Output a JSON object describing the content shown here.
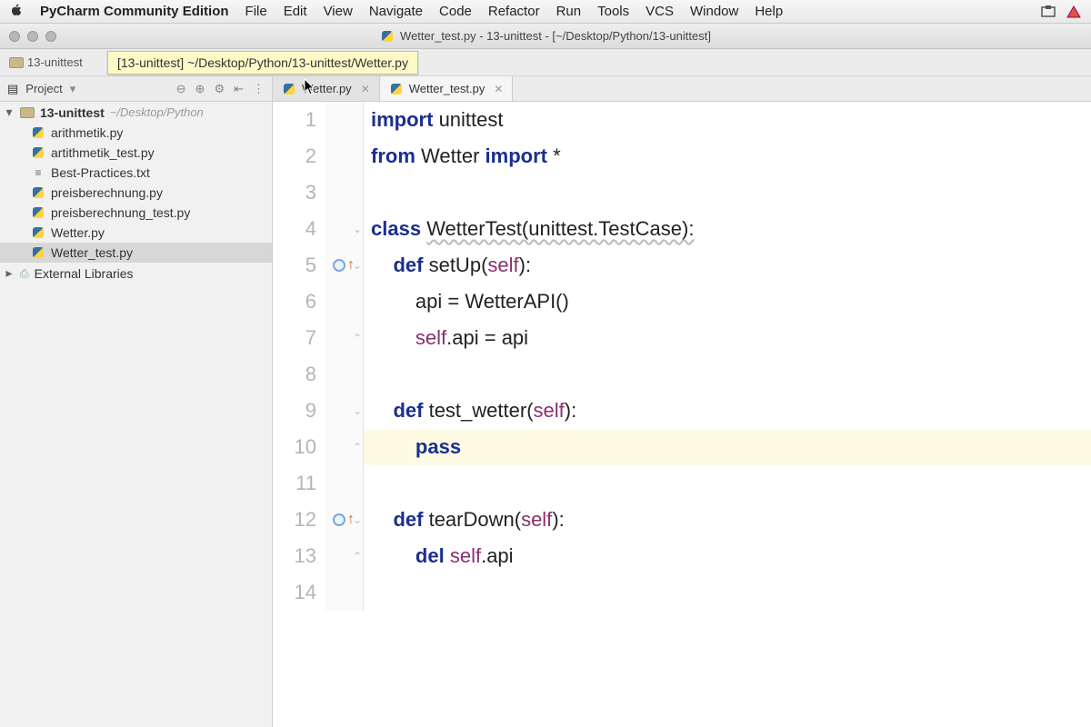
{
  "menubar": {
    "app_name": "PyCharm Community Edition",
    "items": [
      "File",
      "Edit",
      "View",
      "Navigate",
      "Code",
      "Refactor",
      "Run",
      "Tools",
      "VCS",
      "Window",
      "Help"
    ]
  },
  "window": {
    "title": "Wetter_test.py - 13-unittest - [~/Desktop/Python/13-unittest]"
  },
  "breadcrumb": {
    "root": "13-unittest",
    "tooltip": "[13-unittest] ~/Desktop/Python/13-unittest/Wetter.py"
  },
  "project_panel": {
    "label": "Project"
  },
  "tabs": [
    {
      "label": "Wetter.py",
      "active": false
    },
    {
      "label": "Wetter_test.py",
      "active": true
    }
  ],
  "tree": {
    "root": {
      "name": "13-unittest",
      "path": "~/Desktop/Python"
    },
    "files": [
      {
        "name": "arithmetik.py",
        "type": "py"
      },
      {
        "name": "artithmetik_test.py",
        "type": "py"
      },
      {
        "name": "Best-Practices.txt",
        "type": "txt"
      },
      {
        "name": "preisberechnung.py",
        "type": "py"
      },
      {
        "name": "preisberechnung_test.py",
        "type": "py"
      },
      {
        "name": "Wetter.py",
        "type": "py"
      },
      {
        "name": "Wetter_test.py",
        "type": "py",
        "selected": true
      }
    ],
    "external": "External Libraries"
  },
  "editor": {
    "highlighted_line": 10,
    "lines": [
      {
        "n": 1,
        "tokens": [
          [
            "kw",
            "import"
          ],
          [
            " ",
            ""
          ],
          [
            "id",
            "unittest"
          ]
        ]
      },
      {
        "n": 2,
        "tokens": [
          [
            "kw",
            "from"
          ],
          [
            " ",
            ""
          ],
          [
            "id",
            "Wetter"
          ],
          [
            " ",
            ""
          ],
          [
            "kw",
            "import"
          ],
          [
            " ",
            ""
          ],
          [
            "id",
            "*"
          ]
        ]
      },
      {
        "n": 3,
        "tokens": []
      },
      {
        "n": 4,
        "tokens": [
          [
            "kw",
            "class"
          ],
          [
            " ",
            ""
          ],
          [
            "cls",
            "WetterTest(unittest.TestCase):"
          ]
        ],
        "fold": "down"
      },
      {
        "n": 5,
        "indent": 1,
        "tokens": [
          [
            "kw",
            "def"
          ],
          [
            " ",
            ""
          ],
          [
            "fn",
            "setUp"
          ],
          [
            "id",
            "("
          ],
          [
            "self",
            "self"
          ],
          [
            "id",
            "):"
          ]
        ],
        "mark": "override",
        "fold": "down"
      },
      {
        "n": 6,
        "indent": 2,
        "tokens": [
          [
            "id",
            "api = WetterAPI()"
          ]
        ]
      },
      {
        "n": 7,
        "indent": 2,
        "tokens": [
          [
            "self",
            "self"
          ],
          [
            "id",
            ".api = api"
          ]
        ],
        "fold": "up"
      },
      {
        "n": 8,
        "tokens": []
      },
      {
        "n": 9,
        "indent": 1,
        "tokens": [
          [
            "kw",
            "def"
          ],
          [
            " ",
            ""
          ],
          [
            "fn",
            "test_wetter"
          ],
          [
            "id",
            "("
          ],
          [
            "self",
            "self"
          ],
          [
            "id",
            "):"
          ]
        ],
        "fold": "down"
      },
      {
        "n": 10,
        "indent": 2,
        "tokens": [
          [
            "kw",
            "pass"
          ]
        ],
        "fold": "up"
      },
      {
        "n": 11,
        "tokens": []
      },
      {
        "n": 12,
        "indent": 1,
        "tokens": [
          [
            "kw",
            "def"
          ],
          [
            " ",
            ""
          ],
          [
            "fn",
            "tearDown"
          ],
          [
            "id",
            "("
          ],
          [
            "self",
            "self"
          ],
          [
            "id",
            "):"
          ]
        ],
        "mark": "override",
        "fold": "down"
      },
      {
        "n": 13,
        "indent": 2,
        "tokens": [
          [
            "kw",
            "del"
          ],
          [
            " ",
            ""
          ],
          [
            "self",
            "self"
          ],
          [
            "id",
            ".api"
          ]
        ],
        "fold": "up"
      },
      {
        "n": 14,
        "tokens": []
      }
    ]
  }
}
